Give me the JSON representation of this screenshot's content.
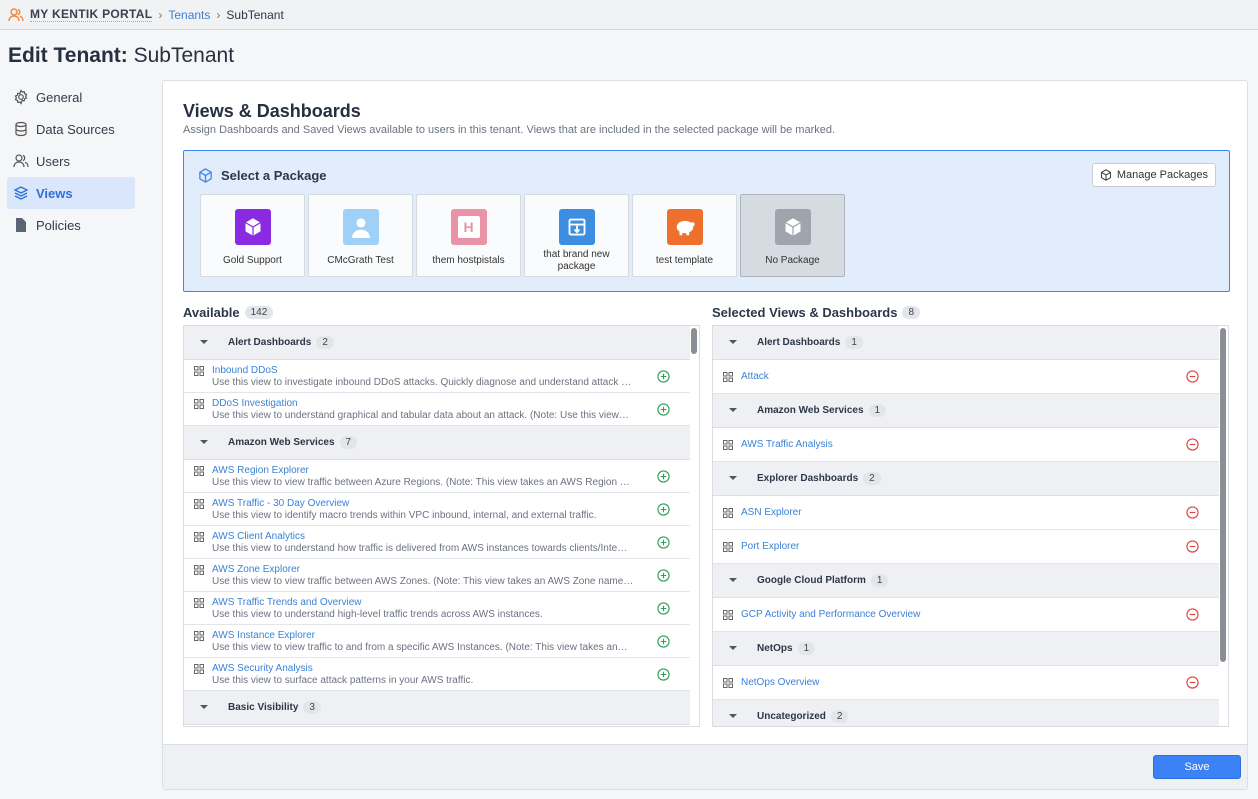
{
  "breadcrumb": {
    "brand": "MY KENTIK PORTAL",
    "link": "Tenants",
    "current": "SubTenant"
  },
  "page_title": {
    "prefix": "Edit Tenant:",
    "name": "SubTenant"
  },
  "sidebar": {
    "items": [
      {
        "label": "General",
        "icon": "gear-icon"
      },
      {
        "label": "Data Sources",
        "icon": "database-icon"
      },
      {
        "label": "Users",
        "icon": "users-icon"
      },
      {
        "label": "Views",
        "icon": "layers-icon",
        "active": true
      },
      {
        "label": "Policies",
        "icon": "file-icon"
      }
    ]
  },
  "section": {
    "title": "Views & Dashboards",
    "subtitle": "Assign Dashboards and Saved Views available to users in this tenant. Views that are included in the selected package will be marked."
  },
  "packages": {
    "label": "Select a Package",
    "manage_label": "Manage Packages",
    "items": [
      {
        "name": "Gold Support",
        "color": "#8a2be2",
        "icon": "cube-icon"
      },
      {
        "name": "CMcGrath Test",
        "color": "#9fd0f7",
        "icon": "user-icon"
      },
      {
        "name": "them hostpistals",
        "color": "#e993a6",
        "icon": "hospital-icon",
        "glyph": "H"
      },
      {
        "name": "that brand new package",
        "color": "#3d8ee0",
        "icon": "box-icon"
      },
      {
        "name": "test template",
        "color": "#ef6f2c",
        "icon": "piggy-bank-icon"
      },
      {
        "name": "No Package",
        "color": "#a0a5ad",
        "icon": "cube-icon",
        "selected": true
      }
    ]
  },
  "available": {
    "label": "Available",
    "count": "142",
    "groups": [
      {
        "name": "Alert Dashboards",
        "count": "2",
        "items": [
          {
            "title": "Inbound DDoS",
            "desc": "Use this view to investigate inbound DDoS attacks. Quickly diagnose and understand attack …"
          },
          {
            "title": "DDoS Investigation",
            "desc": "Use this view to understand graphical and tabular data about an attack. (Note: Use this view…"
          }
        ]
      },
      {
        "name": "Amazon Web Services",
        "count": "7",
        "items": [
          {
            "title": "AWS Region Explorer",
            "desc": "Use this view to view traffic between Azure Regions. (Note: This view takes an AWS Region …"
          },
          {
            "title": "AWS Traffic - 30 Day Overview",
            "desc": "Use this view to identify macro trends within VPC inbound, internal, and external traffic."
          },
          {
            "title": "AWS Client Analytics",
            "desc": "Use this view to understand how traffic is delivered from AWS instances towards clients/Inte…"
          },
          {
            "title": "AWS Zone Explorer",
            "desc": "Use this view to view traffic between AWS Zones. (Note: This view takes an AWS Zone name…"
          },
          {
            "title": "AWS Traffic Trends and Overview",
            "desc": "Use this view to understand high-level traffic trends across AWS instances."
          },
          {
            "title": "AWS Instance Explorer",
            "desc": "Use this view to view traffic to and from a specific AWS Instances. (Note: This view takes an…"
          },
          {
            "title": "AWS Security Analysis",
            "desc": "Use this view to surface attack patterns in your AWS traffic."
          }
        ]
      },
      {
        "name": "Basic Visibility",
        "count": "3",
        "items": []
      }
    ]
  },
  "selected": {
    "label": "Selected Views & Dashboards",
    "count": "8",
    "groups": [
      {
        "name": "Alert Dashboards",
        "count": "1",
        "items": [
          {
            "title": "Attack"
          }
        ]
      },
      {
        "name": "Amazon Web Services",
        "count": "1",
        "items": [
          {
            "title": "AWS Traffic Analysis"
          }
        ]
      },
      {
        "name": "Explorer Dashboards",
        "count": "2",
        "items": [
          {
            "title": "ASN Explorer"
          },
          {
            "title": "Port Explorer"
          }
        ]
      },
      {
        "name": "Google Cloud Platform",
        "count": "1",
        "items": [
          {
            "title": "GCP Activity and Performance Overview"
          }
        ]
      },
      {
        "name": "NetOps",
        "count": "1",
        "items": [
          {
            "title": "NetOps Overview"
          }
        ]
      },
      {
        "name": "Uncategorized",
        "count": "2",
        "items": []
      }
    ]
  },
  "footer": {
    "save_label": "Save"
  },
  "colors": {
    "accent": "#3b82f6",
    "add": "#2e9e57",
    "remove": "#d9443c"
  }
}
